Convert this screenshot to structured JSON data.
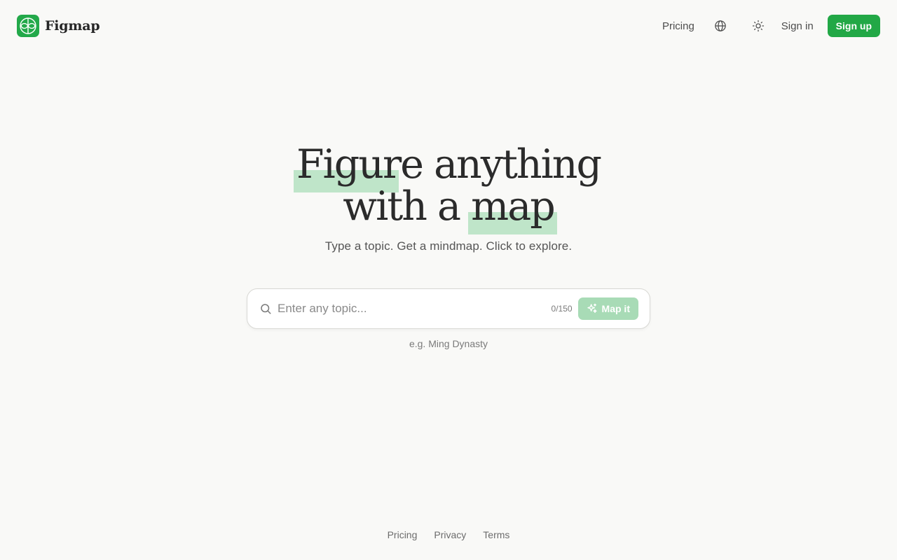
{
  "header": {
    "brand": "Figmap",
    "nav": {
      "pricing": "Pricing",
      "sign_in": "Sign in",
      "sign_up": "Sign up"
    },
    "icons": {
      "logo": "figmap-logo-icon",
      "language": "globe-icon",
      "theme": "sun-icon"
    }
  },
  "hero": {
    "headline_line1_word1": "Figure",
    "headline_line1_rest": "anything",
    "headline_line2_start": "with a",
    "headline_line2_word": "map",
    "subtitle": "Type a topic. Get a mindmap. Click to explore."
  },
  "search": {
    "placeholder": "Enter any topic...",
    "value": "",
    "counter": "0/150",
    "button_label": "Map it",
    "example": "e.g. Ming Dynasty"
  },
  "footer": {
    "links": [
      "Pricing",
      "Privacy",
      "Terms"
    ]
  },
  "colors": {
    "brand_green": "#22a846",
    "highlight": "#bfe5c9",
    "button_disabled": "#a8dbb6",
    "background": "#f9f9f7"
  }
}
